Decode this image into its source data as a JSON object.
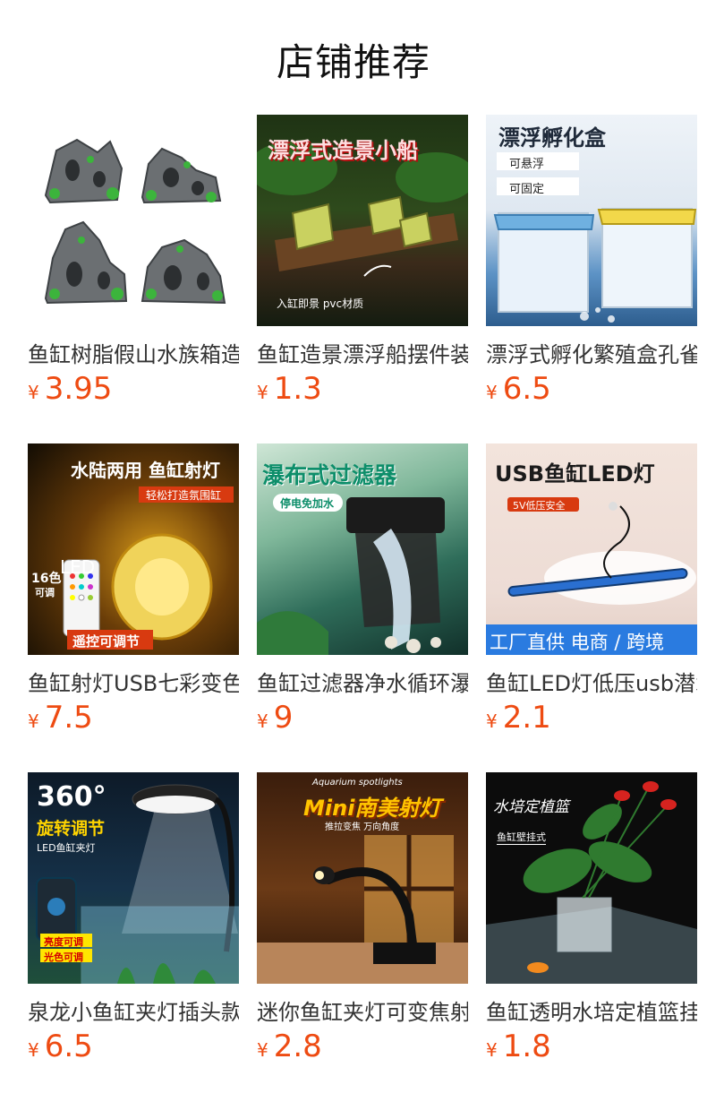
{
  "section_title": "店铺推荐",
  "currency": "¥",
  "products": [
    {
      "title": "鱼缸树脂假山水族箱造景",
      "price": "3.95",
      "overlay": []
    },
    {
      "title": "鱼缸造景漂浮船摆件装饰",
      "price": "1.3",
      "overlay": [
        "漂浮式造景小船",
        "入缸即景 pvc材质"
      ]
    },
    {
      "title": "漂浮式孵化繁殖盒孔雀鱼",
      "price": "6.5",
      "overlay": [
        "漂浮孵化盒",
        "可悬浮",
        "可固定"
      ]
    },
    {
      "title": "鱼缸射灯USB七彩变色灯",
      "price": "7.5",
      "overlay": [
        "水陆两用 鱼缸射灯",
        "轻松打造氛围缸",
        "16色",
        "LED",
        "可调",
        "遥控可调节"
      ]
    },
    {
      "title": "鱼缸过滤器净水循环瀑布",
      "price": "9",
      "overlay": [
        "瀑布式过滤器",
        "停电免加水"
      ]
    },
    {
      "title": "鱼缸LED灯低压usb潜水灯",
      "price": "2.1",
      "overlay": [
        "USB鱼缸LED灯",
        "5V低压安全",
        "工厂直供 电商 / 跨境"
      ]
    },
    {
      "title": "泉龙小鱼缸夹灯插头款",
      "price": "6.5",
      "overlay": [
        "360°",
        "旋转调节",
        "LED鱼缸夹灯",
        "亮度可调",
        "光色可调"
      ]
    },
    {
      "title": "迷你鱼缸夹灯可变焦射灯",
      "price": "2.8",
      "overlay": [
        "Aquarium spotlights",
        "Mini南美射灯",
        "推拉变焦 万向角度"
      ]
    },
    {
      "title": "鱼缸透明水培定植篮挂式",
      "price": "1.8",
      "overlay": [
        "水培定植篮",
        "鱼缸壁挂式"
      ]
    }
  ]
}
